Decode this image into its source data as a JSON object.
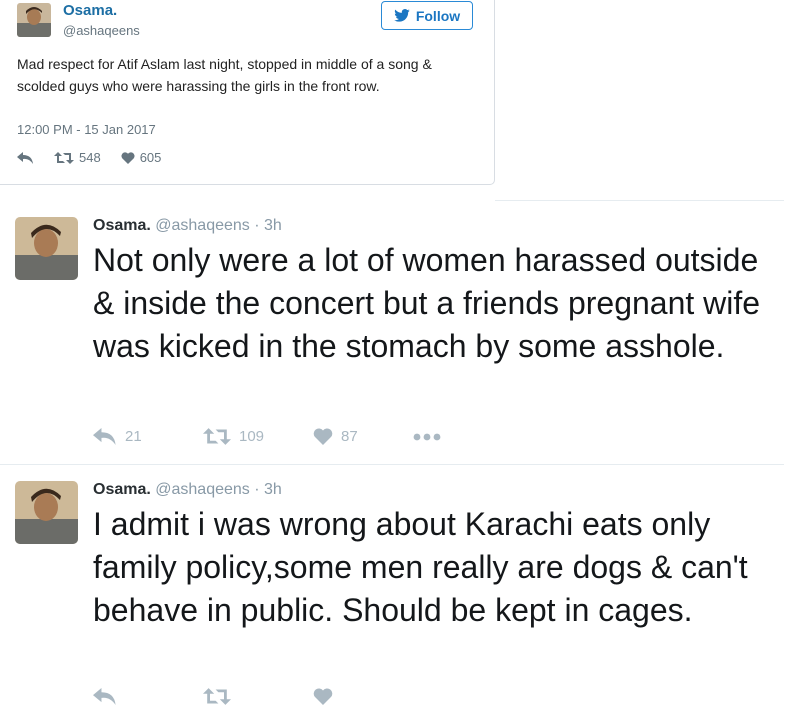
{
  "embed": {
    "name": "Osama.",
    "handle": "@ashaqeens",
    "follow_label": "Follow",
    "text": "Mad respect for Atif Aslam last night, stopped in middle of a song & scolded guys who were harassing the girls in the front row.",
    "timestamp": "12:00 PM - 15 Jan 2017",
    "retweets": "548",
    "likes": "605"
  },
  "tweets": [
    {
      "name": "Osama.",
      "handle": "@ashaqeens",
      "separator": "·",
      "time": "3h",
      "text": "Not only were a lot of women harassed outside & inside the concert but a friends pregnant wife was kicked in the stomach by some asshole.",
      "replies": "21",
      "retweets": "109",
      "likes": "87"
    },
    {
      "name": "Osama.",
      "handle": "@ashaqeens",
      "separator": "·",
      "time": "3h",
      "text": "I admit i was wrong about Karachi eats only family policy,some men really are dogs & can't behave in public. Should be kept in cages."
    }
  ],
  "colors": {
    "link_blue": "#1c6ea4",
    "follow_blue": "#2a8ad6",
    "muted": "#66757f",
    "action_gray": "#aab8c2"
  },
  "icons": [
    "twitter-bird-icon",
    "reply-icon",
    "retweet-icon",
    "heart-icon",
    "more-icon"
  ]
}
